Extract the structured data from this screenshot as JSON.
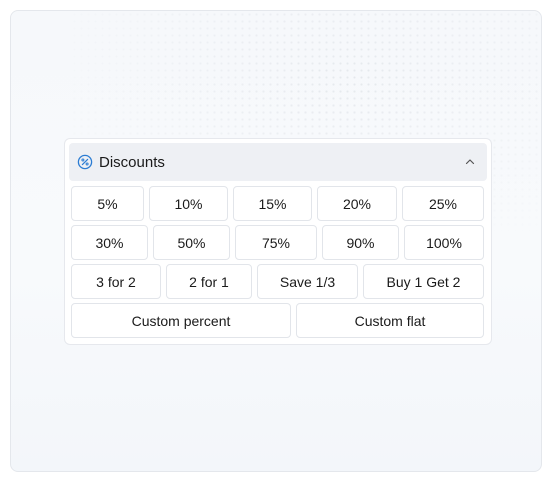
{
  "panel": {
    "title": "Discounts",
    "header_icon": "discount-badge-icon",
    "collapse_icon": "chevron-up-icon",
    "accent_color": "#2b7cd3"
  },
  "rows": [
    [
      "5%",
      "10%",
      "15%",
      "20%",
      "25%"
    ],
    [
      "30%",
      "50%",
      "75%",
      "90%",
      "100%"
    ],
    [
      "3 for 2",
      "2 for 1",
      "Save 1/3",
      "Buy 1 Get 2"
    ],
    [
      "Custom percent",
      "Custom flat"
    ]
  ]
}
